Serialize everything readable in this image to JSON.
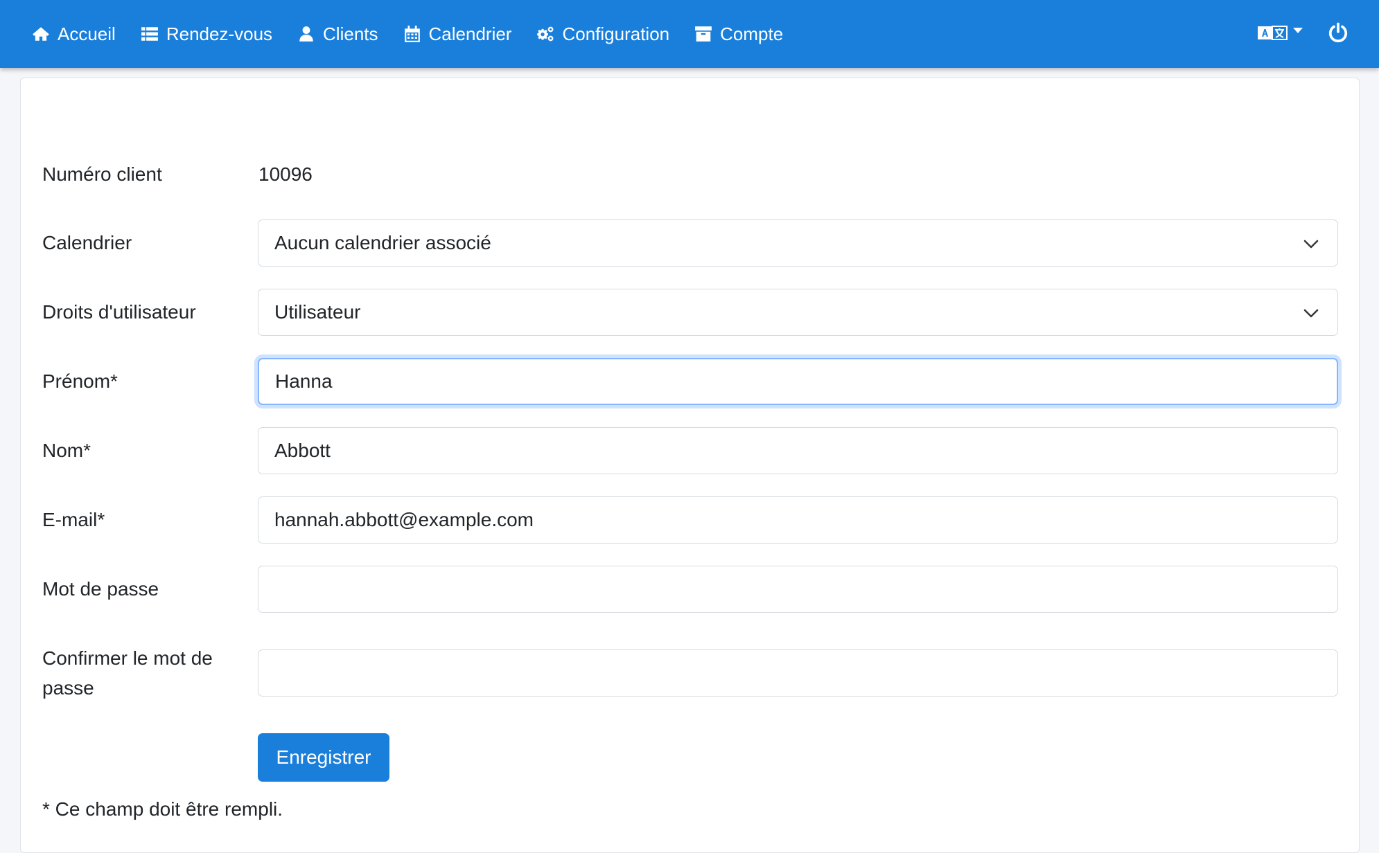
{
  "navbar": {
    "items": [
      {
        "label": "Accueil",
        "icon": "home-icon"
      },
      {
        "label": "Rendez-vous",
        "icon": "list-icon"
      },
      {
        "label": "Clients",
        "icon": "user-icon"
      },
      {
        "label": "Calendrier",
        "icon": "calendar-icon"
      },
      {
        "label": "Configuration",
        "icon": "cogs-icon"
      },
      {
        "label": "Compte",
        "icon": "archive-icon"
      }
    ],
    "language_icon": "language-icon",
    "logout_icon": "power-icon",
    "color": "#1a7fdb"
  },
  "form": {
    "client_number": {
      "label": "Numéro client",
      "value": "10096"
    },
    "calendar": {
      "label": "Calendrier",
      "selected": "Aucun calendrier associé"
    },
    "user_rights": {
      "label": "Droits d'utilisateur",
      "selected": "Utilisateur"
    },
    "first_name": {
      "label": "Prénom*",
      "value": "Hanna"
    },
    "last_name": {
      "label": "Nom*",
      "value": "Abbott"
    },
    "email": {
      "label": "E-mail*",
      "value": "hannah.abbott@example.com"
    },
    "password": {
      "label": "Mot de passe",
      "value": ""
    },
    "confirm_password": {
      "label_line1": "Confirmer le mot de",
      "label_line2": "passe",
      "value": ""
    },
    "save_label": "Enregistrer",
    "required_note": "* Ce champ doit être rempli."
  }
}
